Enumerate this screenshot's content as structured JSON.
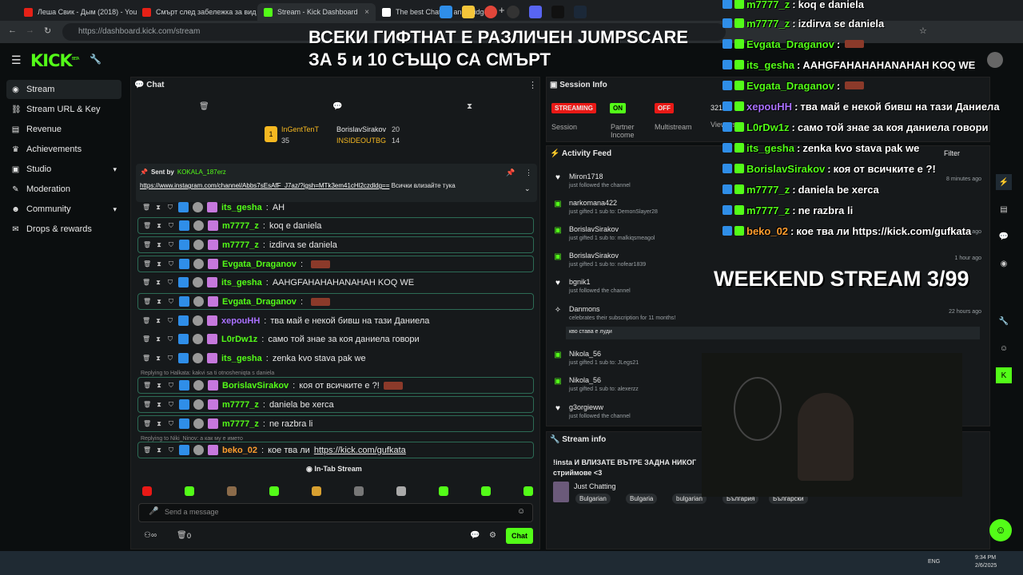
{
  "browser": {
    "tabs": [
      {
        "label": "Леша Свик - Дым (2018) - You"
      },
      {
        "label": "Смърт след забележка за вид"
      },
      {
        "label": "Stream - Kick Dashboard"
      },
      {
        "label": "The best ChatBot and Widgets"
      }
    ],
    "url": "https://dashboard.kick.com/stream"
  },
  "overlay_top": {
    "line1": "ВСЕКИ ГИФТНАТ Е РАЗЛИЧЕН JUMPSCARE",
    "line2": "ЗА 5 и 10 СЪЩО СА СМЪРТ"
  },
  "app": {
    "logo": "KICK",
    "logo_tag": "BETA"
  },
  "sidebar": [
    {
      "label": "Stream",
      "icon": "stream-icon"
    },
    {
      "label": "Stream URL & Key",
      "icon": "link-icon"
    },
    {
      "label": "Revenue",
      "icon": "revenue-icon"
    },
    {
      "label": "Achievements",
      "icon": "trophy-icon"
    },
    {
      "label": "Studio",
      "icon": "studio-icon"
    },
    {
      "label": "Moderation",
      "icon": "wrench-icon"
    },
    {
      "label": "Community",
      "icon": "community-icon"
    },
    {
      "label": "Drops & rewards",
      "icon": "drops-icon"
    }
  ],
  "chat": {
    "title": "Chat",
    "leaderboard": [
      {
        "name": "InGentTenT",
        "count": "35"
      },
      {
        "name": "BorislavSirakov",
        "count": "20"
      },
      {
        "name": "INSIDEOUTBG",
        "count": "14"
      }
    ],
    "pinned": {
      "sent_by": "Sent by",
      "user": "KOKALA_187erz",
      "link": "https://www.instagram.com/channel/Abbs7sEsAfF_J7az/?igsh=MTk3em41cHl2czdldg==",
      "text": "Всички влизайте тука"
    },
    "messages": [
      {
        "user": "its_gesha",
        "text": "АН",
        "color": "#53fc18"
      },
      {
        "user": "m7777_z",
        "text": "koq e daniela",
        "color": "#53fc18"
      },
      {
        "user": "m7777_z",
        "text": "izdirva se daniela",
        "color": "#53fc18"
      },
      {
        "user": "Evgata_Draganov",
        "text": "",
        "color": "#53fc18"
      },
      {
        "user": "its_gesha",
        "text": "AAHGFAHAHAHANAHAH KOQ WE",
        "color": "#53fc18"
      },
      {
        "user": "Evgata_Draganov",
        "text": "",
        "color": "#53fc18"
      },
      {
        "user": "xepouHH",
        "text": "тва май е некой бивш на тази Даниела",
        "color": "#a970ff"
      },
      {
        "user": "L0rDw1z",
        "text": "само той знае за коя даниела говори",
        "color": "#53fc18"
      },
      {
        "user": "its_gesha",
        "text": "zenka kvo stava pak we",
        "color": "#53fc18"
      },
      {
        "user": "BorislavSirakov",
        "text": "коя от всичките е ?!",
        "color": "#53fc18"
      },
      {
        "user": "m7777_z",
        "text": "daniela be xerca",
        "color": "#53fc18"
      },
      {
        "user": "m7777_z",
        "text": "ne razbra li",
        "color": "#53fc18"
      },
      {
        "user": "beko_02",
        "text": "кое тва ли",
        "link": "https://kick.com/gufkata",
        "color": "#ff9d2e"
      }
    ],
    "reply1": "Replying to Halkata: kakvi sa ti otnosheniqta s daniela",
    "reply2": "Replying to Niki_Ninov: а как му е името",
    "in_tab": "In-Tab Stream",
    "placeholder": "Send a message",
    "count": "0",
    "send_label": "Chat"
  },
  "session": {
    "title": "Session Info",
    "items": [
      {
        "badge": "STREAMING",
        "label": "Session",
        "color": "#e91916"
      },
      {
        "badge": "ON",
        "label": "Partner Income",
        "color": "#53fc18"
      },
      {
        "badge": "OFF",
        "label": "Multistream",
        "color": "#e91916"
      }
    ],
    "viewers": "321",
    "viewers_label": "Viewers"
  },
  "activity": {
    "title": "Activity Feed",
    "filter": "Filter",
    "items": [
      {
        "name": "Miron1718",
        "sub": "just followed the channel",
        "time": "8 minutes ago",
        "icon": "heart-icon"
      },
      {
        "name": "narkomana422",
        "sub": "just gifted 1 sub to: DemonSlayer28",
        "time": "",
        "icon": "gift-icon"
      },
      {
        "name": "BorislavSirakov",
        "sub": "just gifted 1 sub to: malkiqsmeagol",
        "time": "52 minutes ago",
        "icon": "gift-icon"
      },
      {
        "name": "BorislavSirakov",
        "sub": "just gifted 1 sub to: nofear1839",
        "time": "1 hour ago",
        "icon": "gift-icon"
      },
      {
        "name": "bgnik1",
        "sub": "just followed the channel",
        "time": "",
        "icon": "heart-icon"
      },
      {
        "name": "Danmons",
        "sub": "celebrates their subscription for 11 months!",
        "time": "22 hours ago",
        "icon": "star-icon"
      },
      {
        "name": "Nikola_56",
        "sub": "just gifted 1 sub to: JLegs21",
        "time": "",
        "icon": "gift-icon"
      },
      {
        "name": "Nikola_56",
        "sub": "just gifted 1 sub to: alexerzz",
        "time": "",
        "icon": "gift-icon"
      },
      {
        "name": "g3orgieww",
        "sub": "just followed the channel",
        "time": "",
        "icon": "heart-icon"
      }
    ],
    "danmons_note": "кво става е луди"
  },
  "stream_info": {
    "title": "Stream info",
    "stream_title": "!insta И ВЛИЗАТЕ ВЪТРЕ ЗАДНА НИКОГ",
    "stream_title2": "стриймове <3",
    "category": "Just Chatting",
    "tags": [
      "Bulgarian",
      "Bulgaria",
      "bulgarian",
      "България",
      "Български"
    ]
  },
  "overlay_chat": [
    {
      "user": "m7777_z",
      "text": "koq e daniela"
    },
    {
      "user": "m7777_z",
      "text": "izdirva se daniela"
    },
    {
      "user": "Evgata_Draganov",
      "text": ""
    },
    {
      "user": "its_gesha",
      "text": "AAHGFAHAHAHANAHAH KOQ WE"
    },
    {
      "user": "Evgata_Draganov",
      "text": ""
    },
    {
      "user": "xepouHH",
      "text": "тва май е некой бивш на тази Даниела"
    },
    {
      "user": "L0rDw1z",
      "text": "само той знае за коя даниела говори"
    },
    {
      "user": "its_gesha",
      "text": "zenka kvo stava pak we"
    },
    {
      "user": "BorislavSirakov",
      "text": "коя от всичките е ?!"
    },
    {
      "user": "m7777_z",
      "text": "daniela be xerca"
    },
    {
      "user": "m7777_z",
      "text": "ne razbra li"
    },
    {
      "user": "beko_02",
      "text": "кое тва ли https://kick.com/gufkata"
    }
  ],
  "weekend": "WEEKEND STREAM 3/99",
  "taskbar": {
    "lang": "ENG",
    "time": "9:34 PM",
    "date": "2/6/2025"
  }
}
